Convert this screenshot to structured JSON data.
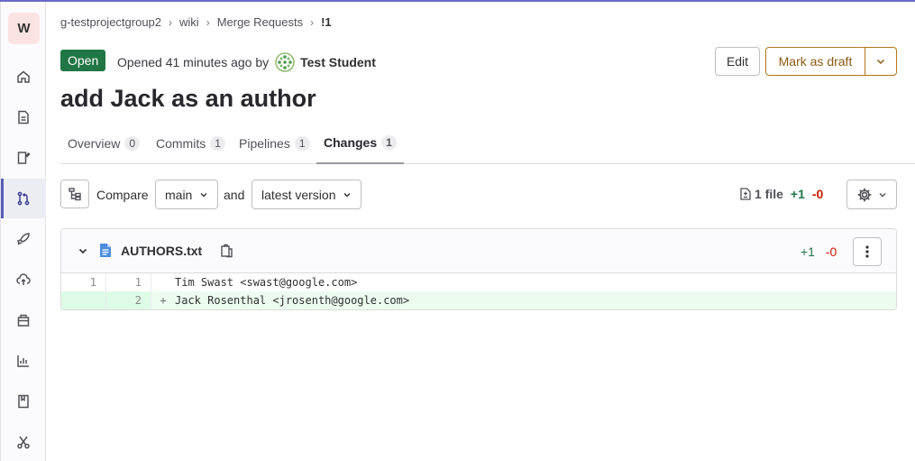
{
  "sidebar": {
    "project_initial": "W",
    "icons": [
      "home-icon",
      "document-icon",
      "issues-icon",
      "merge-request-icon",
      "rocket-icon",
      "deploy-icon",
      "package-icon",
      "analytics-icon",
      "wiki-icon",
      "snippets-icon"
    ]
  },
  "breadcrumb": {
    "group": "g-testprojectgroup2",
    "project": "wiki",
    "section": "Merge Requests",
    "current": "!1"
  },
  "header": {
    "status": "Open",
    "opened_text": "Opened 41 minutes ago by",
    "author": "Test Student",
    "edit_label": "Edit",
    "draft_label": "Mark as draft",
    "title": "add Jack as an author"
  },
  "tabs": [
    {
      "label": "Overview",
      "count": "0"
    },
    {
      "label": "Commits",
      "count": "1"
    },
    {
      "label": "Pipelines",
      "count": "1"
    },
    {
      "label": "Changes",
      "count": "1"
    }
  ],
  "toolbar": {
    "compare_label": "Compare",
    "base_branch": "main",
    "and_label": "and",
    "target_version": "latest version",
    "files_changed": "1 file",
    "additions": "+1",
    "deletions": "-0"
  },
  "diff": {
    "file_name": "AUTHORS.txt",
    "additions": "+1",
    "deletions": "-0",
    "lines": [
      {
        "old": "1",
        "new": "1",
        "marker": "",
        "text": "Tim Swast <swast@google.com>"
      },
      {
        "old": "",
        "new": "2",
        "marker": "+",
        "text": "Jack Rosenthal <jrosenth@google.com>"
      }
    ]
  },
  "colors": {
    "status_open": "#217645",
    "draft_border": "#b3771a",
    "addition": "#217645",
    "deletion": "#c91c00",
    "added_line_bg": "#ecfdf0"
  }
}
